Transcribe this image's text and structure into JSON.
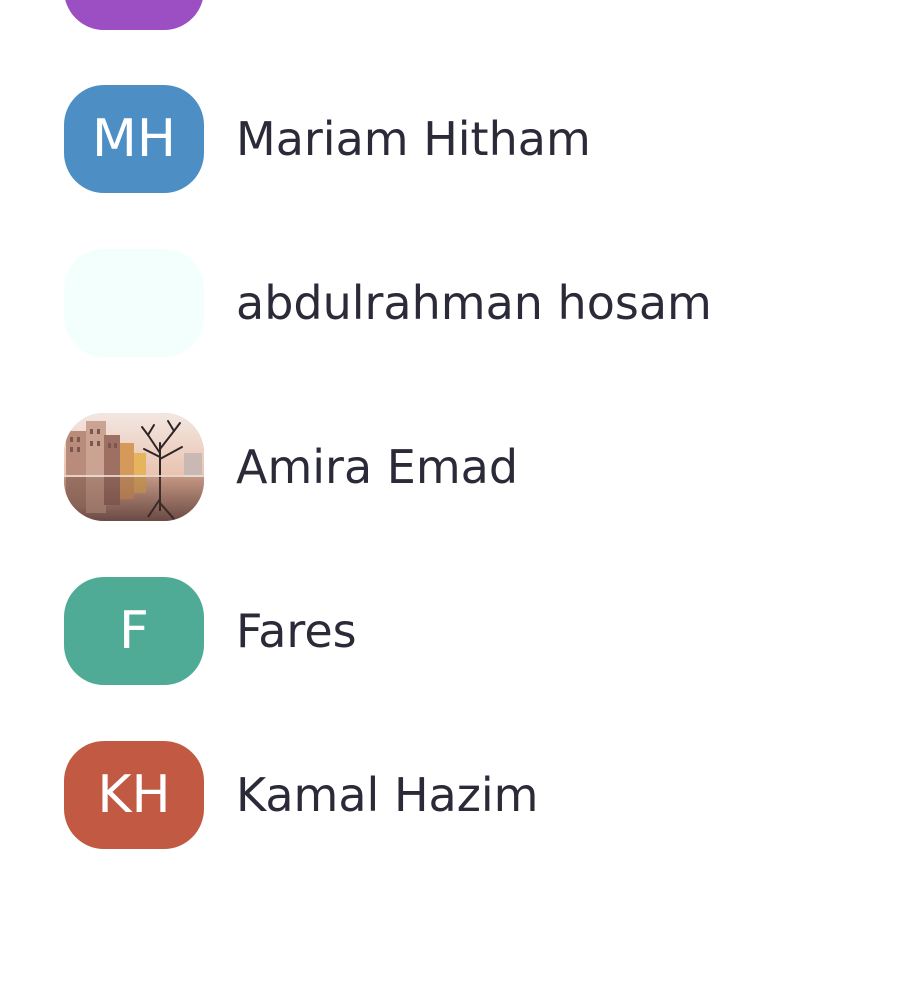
{
  "contacts": [
    {
      "initials": "",
      "name": "",
      "color": "#9b4fc2",
      "avatar": "initials"
    },
    {
      "initials": "MH",
      "name": "Mariam Hitham",
      "color": "#4d8fc5",
      "avatar": "initials"
    },
    {
      "initials": "",
      "name": "abdulrahman hosam",
      "color": "#f3fffd",
      "avatar": "blank"
    },
    {
      "initials": "",
      "name": "Amira Emad",
      "color": "#d8a88f",
      "avatar": "photo"
    },
    {
      "initials": "F",
      "name": "Fares",
      "color": "#4fab95",
      "avatar": "initials"
    },
    {
      "initials": "KH",
      "name": "Kamal Hazim",
      "color": "#c25a43",
      "avatar": "initials"
    }
  ]
}
